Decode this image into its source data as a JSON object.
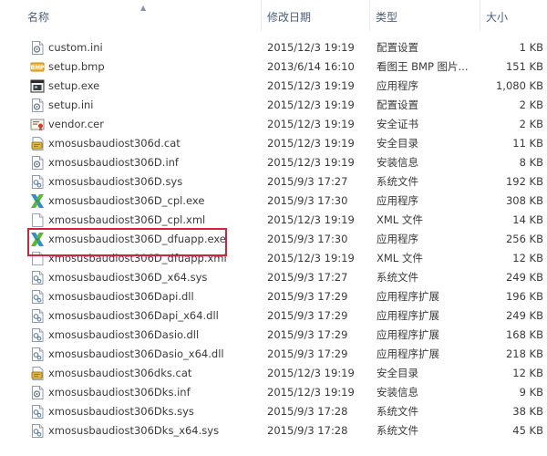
{
  "columns": {
    "name": "名称",
    "date": "修改日期",
    "type": "类型",
    "size": "大小"
  },
  "files": [
    {
      "name": "custom.ini",
      "date": "2015/12/3 19:19",
      "type": "配置设置",
      "size": "1 KB",
      "icon": "ini-icon"
    },
    {
      "name": "setup.bmp",
      "date": "2013/6/14 16:10",
      "type": "看图王 BMP 图片...",
      "size": "151 KB",
      "icon": "bmp-icon"
    },
    {
      "name": "setup.exe",
      "date": "2015/12/3 19:19",
      "type": "应用程序",
      "size": "1,080 KB",
      "icon": "exe-icon"
    },
    {
      "name": "setup.ini",
      "date": "2015/12/3 19:19",
      "type": "配置设置",
      "size": "2 KB",
      "icon": "ini-icon"
    },
    {
      "name": "vendor.cer",
      "date": "2015/12/3 19:19",
      "type": "安全证书",
      "size": "2 KB",
      "icon": "cer-icon"
    },
    {
      "name": "xmosusbaudiost306d.cat",
      "date": "2015/12/3 19:19",
      "type": "安全目录",
      "size": "11 KB",
      "icon": "cat-icon"
    },
    {
      "name": "xmosusbaudiost306D.inf",
      "date": "2015/12/3 19:19",
      "type": "安装信息",
      "size": "8 KB",
      "icon": "inf-icon"
    },
    {
      "name": "xmosusbaudiost306D.sys",
      "date": "2015/9/3 17:27",
      "type": "系统文件",
      "size": "192 KB",
      "icon": "sys-icon"
    },
    {
      "name": "xmosusbaudiost306D_cpl.exe",
      "date": "2015/9/3 17:30",
      "type": "应用程序",
      "size": "308 KB",
      "icon": "xmos-icon"
    },
    {
      "name": "xmosusbaudiost306D_cpl.xml",
      "date": "2015/12/3 19:19",
      "type": "XML 文件",
      "size": "14 KB",
      "icon": "xml-icon"
    },
    {
      "name": "xmosusbaudiost306D_dfuapp.exe",
      "date": "2015/9/3 17:30",
      "type": "应用程序",
      "size": "256 KB",
      "icon": "xmos-icon"
    },
    {
      "name": "xmosusbaudiost306D_dfuapp.xml",
      "date": "2015/12/3 19:19",
      "type": "XML 文件",
      "size": "12 KB",
      "icon": "xml-icon"
    },
    {
      "name": "xmosusbaudiost306D_x64.sys",
      "date": "2015/9/3 17:27",
      "type": "系统文件",
      "size": "249 KB",
      "icon": "sys-icon"
    },
    {
      "name": "xmosusbaudiost306Dapi.dll",
      "date": "2015/9/3 17:29",
      "type": "应用程序扩展",
      "size": "196 KB",
      "icon": "dll-icon"
    },
    {
      "name": "xmosusbaudiost306Dapi_x64.dll",
      "date": "2015/9/3 17:29",
      "type": "应用程序扩展",
      "size": "249 KB",
      "icon": "dll-icon"
    },
    {
      "name": "xmosusbaudiost306Dasio.dll",
      "date": "2015/9/3 17:29",
      "type": "应用程序扩展",
      "size": "168 KB",
      "icon": "dll-icon"
    },
    {
      "name": "xmosusbaudiost306Dasio_x64.dll",
      "date": "2015/9/3 17:29",
      "type": "应用程序扩展",
      "size": "218 KB",
      "icon": "dll-icon"
    },
    {
      "name": "xmosusbaudiost306dks.cat",
      "date": "2015/12/3 19:19",
      "type": "安全目录",
      "size": "12 KB",
      "icon": "cat-icon"
    },
    {
      "name": "xmosusbaudiost306Dks.inf",
      "date": "2015/12/3 19:19",
      "type": "安装信息",
      "size": "9 KB",
      "icon": "inf-icon"
    },
    {
      "name": "xmosusbaudiost306Dks.sys",
      "date": "2015/9/3 17:28",
      "type": "系统文件",
      "size": "38 KB",
      "icon": "sys-icon"
    },
    {
      "name": "xmosusbaudiost306Dks_x64.sys",
      "date": "2015/9/3 17:28",
      "type": "系统文件",
      "size": "45 KB",
      "icon": "sys-icon"
    }
  ],
  "highlighted_file": "xmosusbaudiost306D_dfuapp.exe",
  "colors": {
    "highlight_border": "#d0243c",
    "header_text": "#4c607a",
    "xmos_blue": "#2a8fd6",
    "xmos_green": "#5cb82e"
  }
}
